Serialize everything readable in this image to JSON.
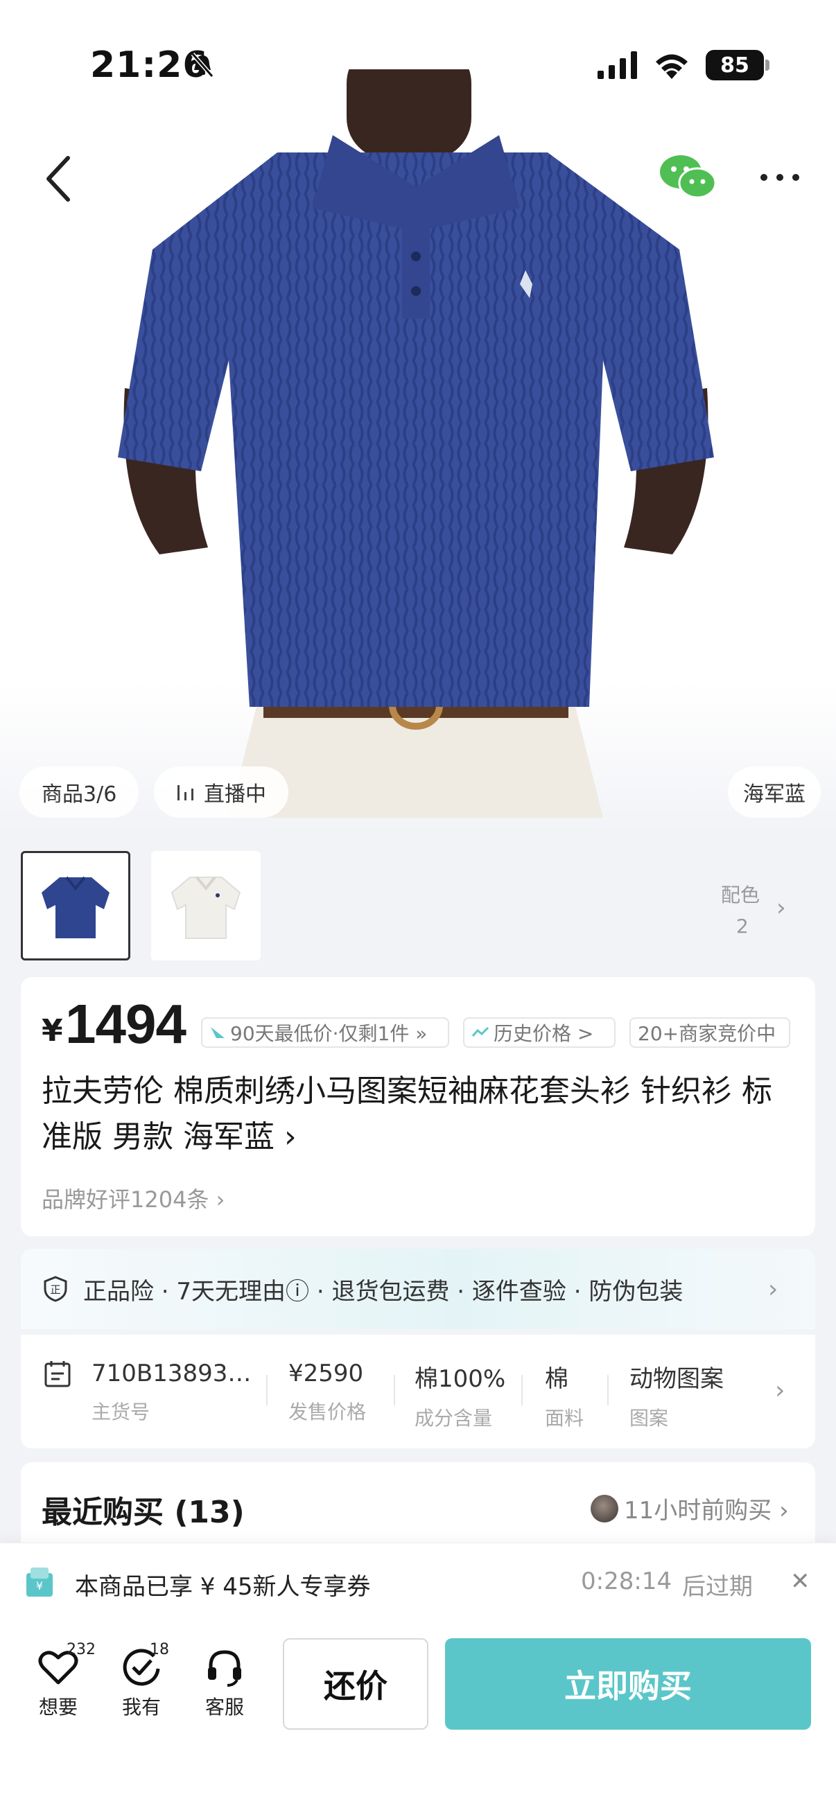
{
  "status_bar": {
    "time": "21:26",
    "battery": "85"
  },
  "hero": {
    "image_count": "商品3/6",
    "live_label": "直播中",
    "color_label": "海军蓝",
    "variants_label": "配色",
    "variants_count": "2"
  },
  "product": {
    "currency": "¥",
    "price": "1494",
    "tags": [
      "90天最低价·仅剩1件 »",
      "历史价格 >",
      "20+商家竞价中"
    ],
    "title": "拉夫劳伦 棉质刺绣小马图案短袖麻花套头衫 针织衫 标准版 男款 海军蓝 ›",
    "brand_reviews": "品牌好评1204条 ›"
  },
  "guarantee": {
    "text": "正品险 · 7天无理由ⓘ · 退货包运费 · 逐件查验 · 防伪包装"
  },
  "specs": [
    {
      "value": "710B13893…",
      "key": "主货号"
    },
    {
      "value": "¥2590",
      "key": "发售价格"
    },
    {
      "value": "棉100%",
      "key": "成分含量"
    },
    {
      "value": "棉",
      "key": "面料"
    },
    {
      "value": "动物图案",
      "key": "图案"
    }
  ],
  "recent": {
    "title": "最近购买 (13)",
    "latest": "11小时前购买 ›"
  },
  "coupon": {
    "text": "本商品已享 ¥ 45新人专享券",
    "timer": "0:28:14",
    "expires": "后过期"
  },
  "bottom_bar": {
    "want_label": "想要",
    "want_count": "232",
    "have_label": "我有",
    "have_count": "18",
    "service_label": "客服",
    "haggle_label": "还价",
    "buy_label": "立即购买"
  },
  "colors": {
    "accent": "#5bc6c9",
    "shirt": "#3a4f9c"
  }
}
